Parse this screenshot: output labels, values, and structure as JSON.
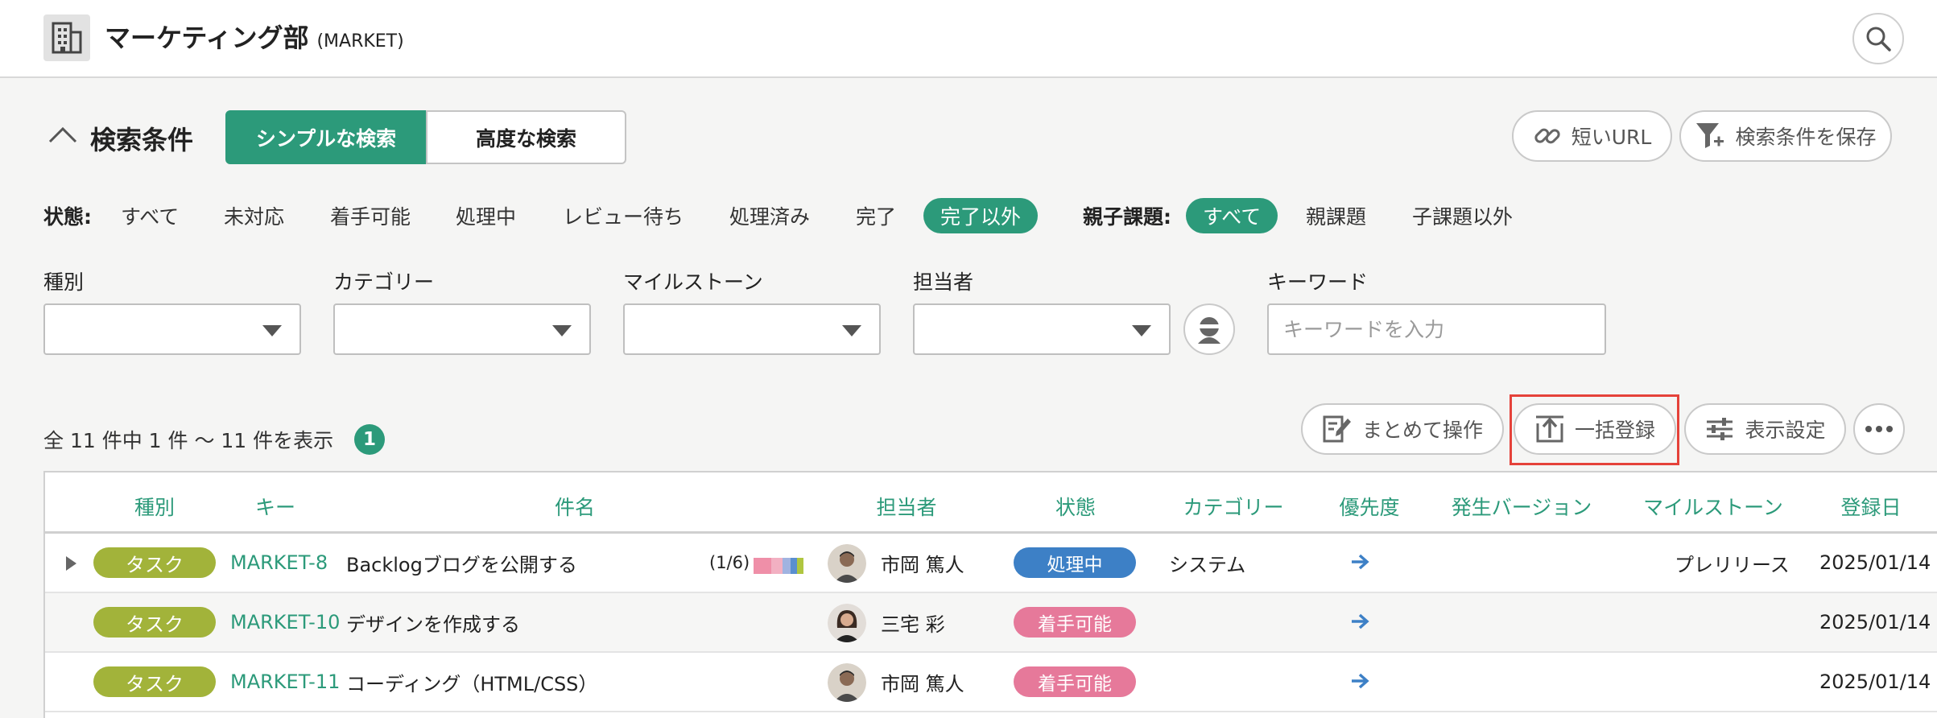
{
  "header": {
    "project_name": "マーケティング部",
    "project_key": "(MARKET)",
    "icon": "building-icon",
    "search_icon": "search-icon"
  },
  "search": {
    "title": "検索条件",
    "tabs": [
      "シンプルな検索",
      "高度な検索"
    ],
    "active_tab": "シンプルな検索",
    "short_url_label": "短いURL",
    "save_condition_label": "検索条件を保存",
    "status_label": "状態:",
    "status_options": [
      "すべて",
      "未対応",
      "着手可能",
      "処理中",
      "レビュー待ち",
      "処理済み",
      "完了",
      "完了以外"
    ],
    "status_active": "完了以外",
    "parent_label": "親子課題:",
    "parent_options": [
      "すべて",
      "親課題",
      "子課題以外"
    ],
    "parent_active": "すべて",
    "fields": {
      "type": "種別",
      "category": "カテゴリー",
      "milestone": "マイルストーン",
      "assignee": "担当者",
      "keyword": "キーワード"
    },
    "keyword_placeholder": "キーワードを入力"
  },
  "results": {
    "count_text": "全 11 件中 1 件 〜 11 件を表示",
    "page": "1",
    "bulk_edit_label": "まとめて操作",
    "bulk_register_label": "一括登録",
    "display_settings_label": "表示設定"
  },
  "table": {
    "columns": [
      "種別",
      "キー",
      "件名",
      "担当者",
      "状態",
      "カテゴリー",
      "優先度",
      "発生バージョン",
      "マイルストーン",
      "登録日"
    ],
    "rows": [
      {
        "type": "タスク",
        "key": "MARKET-8",
        "subject": "Backlogブログを公開する",
        "progress": "(1/6)",
        "assignee": "市岡 篤人",
        "status": "処理中",
        "status_color": "#3d80c6",
        "category": "システム",
        "priority": "arrow-right-icon",
        "version": "",
        "milestone": "プレリリース",
        "created": "2025/01/14",
        "expandable": true
      },
      {
        "type": "タスク",
        "key": "MARKET-10",
        "subject": "デザインを作成する",
        "progress": "",
        "assignee": "三宅 彩",
        "status": "着手可能",
        "status_color": "#e6799a",
        "category": "",
        "priority": "arrow-right-icon",
        "version": "",
        "milestone": "",
        "created": "2025/01/14",
        "expandable": false
      },
      {
        "type": "タスク",
        "key": "MARKET-11",
        "subject": "コーディング（HTML/CSS）",
        "progress": "",
        "assignee": "市岡 篤人",
        "status": "着手可能",
        "status_color": "#e6799a",
        "category": "",
        "priority": "arrow-right-icon",
        "version": "",
        "milestone": "",
        "created": "2025/01/14",
        "expandable": false
      }
    ]
  },
  "colors": {
    "accent": "#2c9a7a",
    "type_task": "#a2b33a",
    "highlight": "#e5423a"
  }
}
